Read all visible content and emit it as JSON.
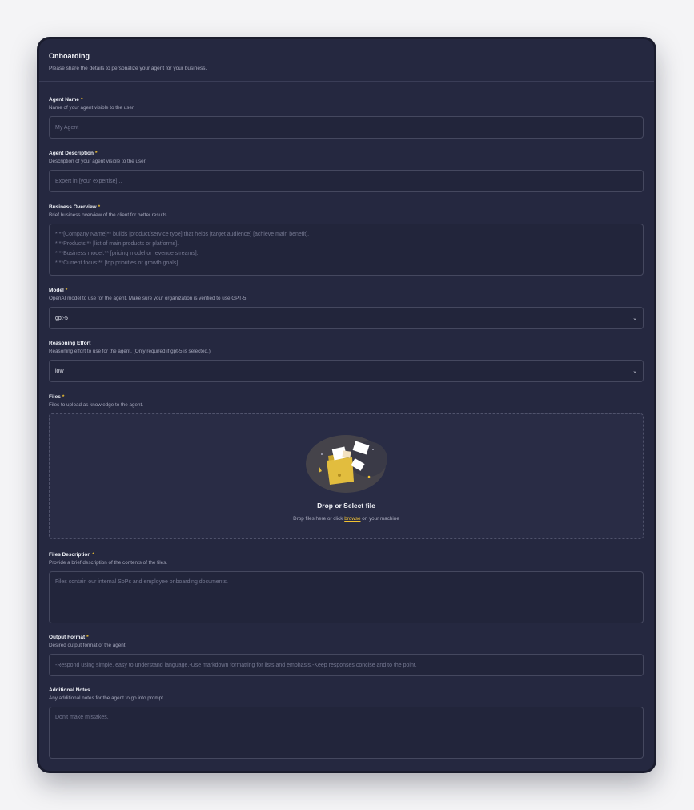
{
  "header": {
    "title": "Onboarding",
    "subtitle": "Please share the details to personalize your agent for your business."
  },
  "fields": {
    "agent_name": {
      "label": "Agent Name",
      "help": "Name of your agent visible to the user.",
      "placeholder": "My Agent"
    },
    "agent_description": {
      "label": "Agent Description",
      "help": "Description of your agent visible to the user.",
      "placeholder": "Expert in [your expertise]..."
    },
    "business_overview": {
      "label": "Business Overview",
      "help": "Brief business overview of the client for better results.",
      "placeholder_lines": [
        "* **[Company Name]** builds [product/service type] that helps [target audience] [achieve main benefit].",
        "* **Products:** [list of main products or platforms].",
        "* **Business model:** [pricing model or revenue streams].",
        "* **Current focus:** [top priorities or growth goals]."
      ]
    },
    "model": {
      "label": "Model",
      "help": "OpenAI model to use for the agent. Make sure your organization is verified to use GPT-5.",
      "value": "gpt-5"
    },
    "reasoning_effort": {
      "label": "Reasoning Effort",
      "help": "Reasoning effort to use for the agent. (Only required if gpt-5 is selected.)",
      "value": "low"
    },
    "files": {
      "label": "Files",
      "help": "Files to upload as knowledge to the agent.",
      "drop_title": "Drop or Select file",
      "drop_hint_before": "Drop files here or click",
      "drop_hint_link": "browse",
      "drop_hint_after": "on your machine"
    },
    "files_description": {
      "label": "Files Description",
      "help": "Provide a brief description of the contents of the files.",
      "placeholder": "Files contain our internal SoPs and employee onboarding documents."
    },
    "output_format": {
      "label": "Output Format",
      "help": "Desired output format of the agent.",
      "placeholder": "-Respond using simple, easy to understand language.-Use markdown formatting for lists and emphasis.-Keep responses concise and to the point."
    },
    "additional_notes": {
      "label": "Additional Notes",
      "help": "Any additional notes for the agent to go into prompt.",
      "placeholder": "Don't make mistakes."
    }
  },
  "required_marker": "*",
  "icons": {
    "select_chevron": "chevron-down-icon",
    "upload_illustration": "folder-upload-icon"
  },
  "colors": {
    "accent": "#f1c232",
    "card_bg": "#252840",
    "page_bg": "#f4f4f6"
  }
}
